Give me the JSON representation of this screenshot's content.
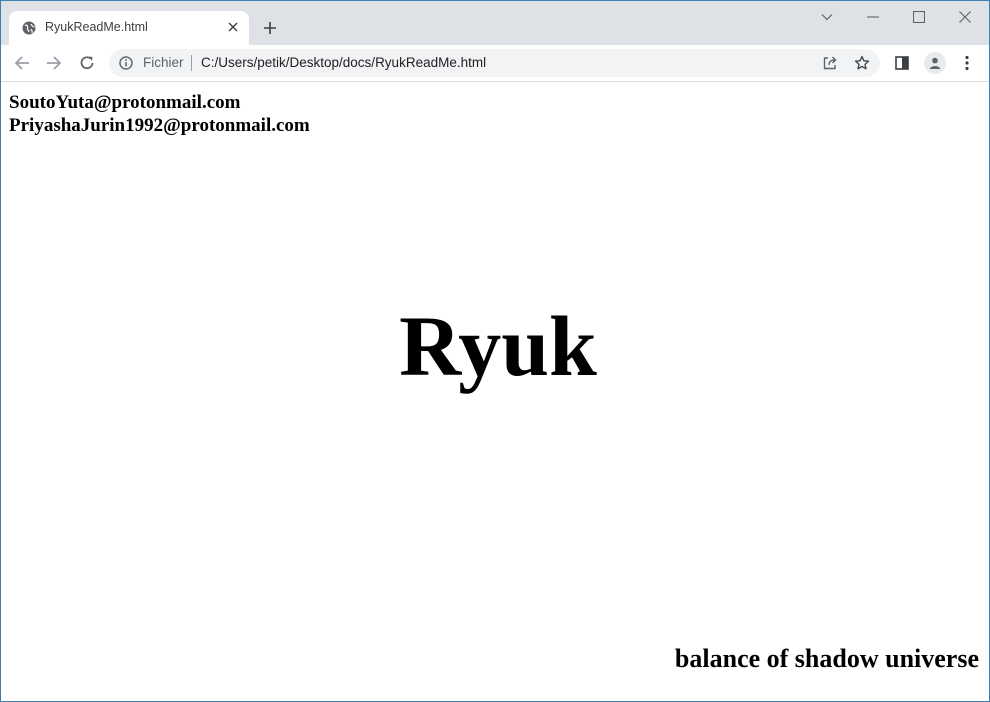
{
  "browser": {
    "tab": {
      "title": "RyukReadMe.html",
      "favicon": "globe-icon"
    },
    "new_tab_icon": "plus-icon",
    "window_controls": [
      "chevron-down-icon",
      "minimize-icon",
      "maximize-icon",
      "close-icon"
    ],
    "toolbar": {
      "back_icon": "back-arrow-icon",
      "forward_icon": "forward-arrow-icon",
      "reload_icon": "reload-icon",
      "site_info_icon": "info-icon",
      "scheme_label": "Fichier",
      "url": "C:/Users/petik/Desktop/docs/RyukReadMe.html",
      "share_icon": "share-icon",
      "bookmark_icon": "star-icon",
      "side_panel_icon": "side-panel-icon",
      "profile_icon": "profile-icon",
      "menu_icon": "kebab-menu-icon"
    }
  },
  "page": {
    "contact_emails": [
      "SoutoYuta@protonmail.com",
      "PriyashaJurin1992@protonmail.com"
    ],
    "headline": "Ryuk",
    "footer_text": "balance of shadow universe",
    "text_color": "#000000",
    "background_color": "#ffffff"
  }
}
